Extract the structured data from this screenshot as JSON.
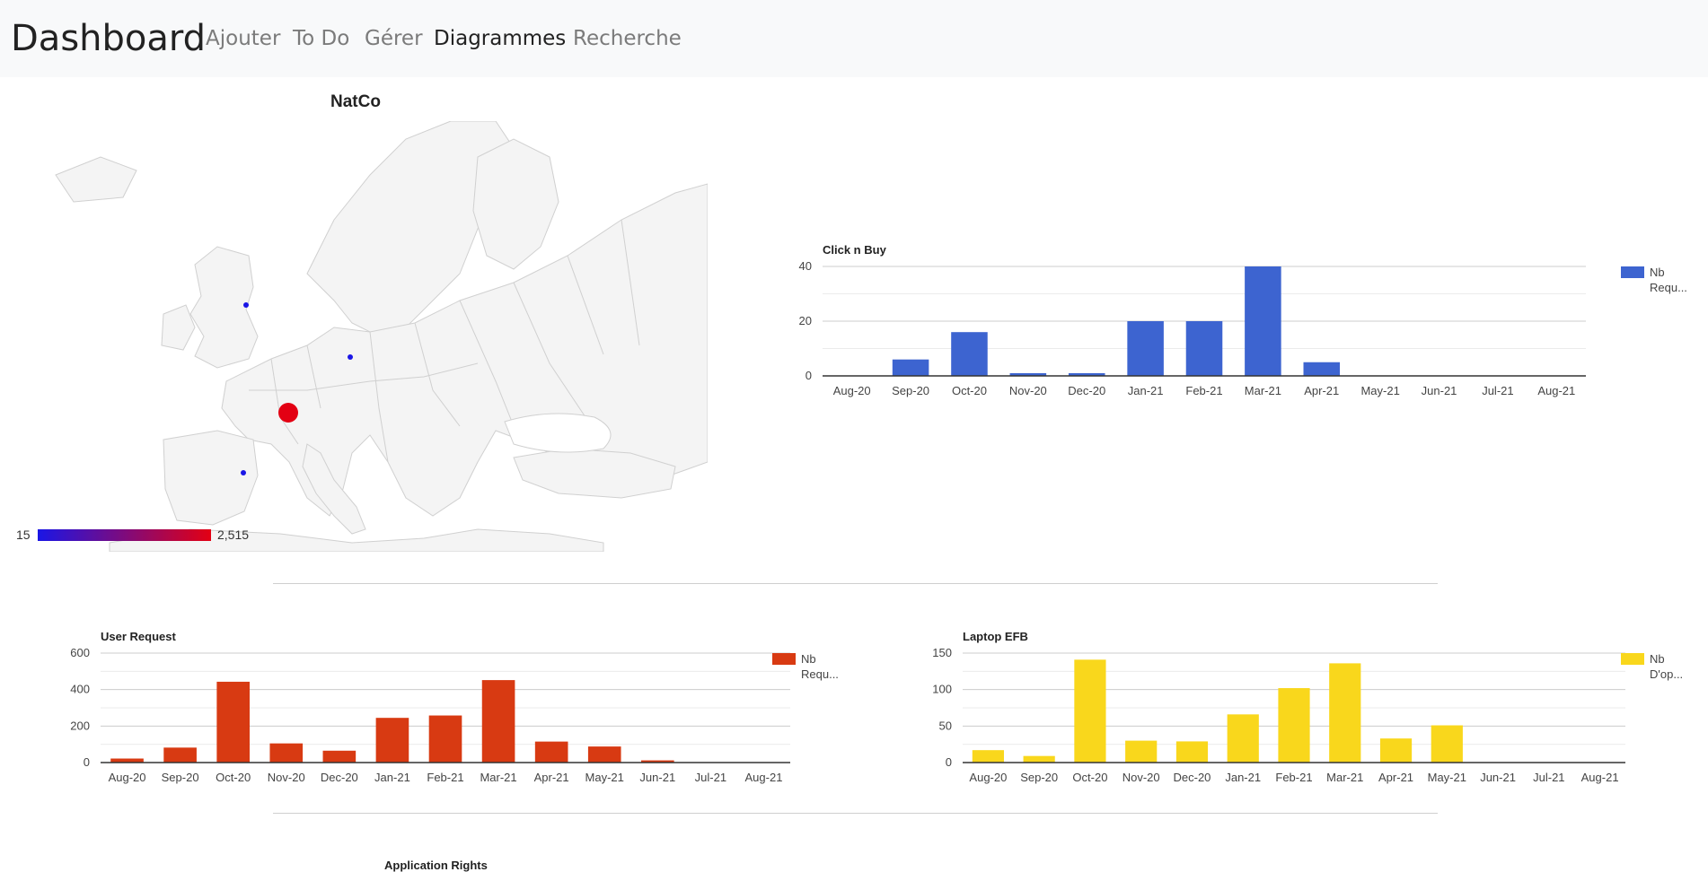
{
  "navbar": {
    "brand": "Dashboard",
    "links": [
      {
        "label": "Ajouter",
        "active": false
      },
      {
        "label": "To Do",
        "active": false
      },
      {
        "label": "Gérer",
        "active": false
      },
      {
        "label": "Diagrammes",
        "active": true
      },
      {
        "label": "Recherche",
        "active": false
      }
    ]
  },
  "map": {
    "title": "NatCo",
    "legend_min": "15",
    "legend_max": "2,515",
    "colors": {
      "min": "#1a16e6",
      "max": "#e30013",
      "land": "#f4f4f4",
      "border": "#d0d0d0"
    }
  },
  "chart_data": [
    {
      "type": "bar",
      "title": "Click n Buy",
      "categories": [
        "Aug-20",
        "Sep-20",
        "Oct-20",
        "Nov-20",
        "Dec-20",
        "Jan-21",
        "Feb-21",
        "Mar-21",
        "Apr-21",
        "May-21",
        "Jun-21",
        "Jul-21",
        "Aug-21"
      ],
      "series": [
        {
          "name": "Nb Requ...",
          "values": [
            0,
            6,
            16,
            1,
            1,
            20,
            20,
            40,
            5,
            0,
            0,
            0,
            0
          ],
          "color": "#3d64d0"
        }
      ],
      "yticks": [
        "0",
        "20",
        "40"
      ],
      "ylim": [
        0,
        40
      ],
      "legend_position": "right",
      "grid": true
    },
    {
      "type": "bar",
      "title": "User Request",
      "categories": [
        "Aug-20",
        "Sep-20",
        "Oct-20",
        "Nov-20",
        "Dec-20",
        "Jan-21",
        "Feb-21",
        "Mar-21",
        "Apr-21",
        "May-21",
        "Jun-21",
        "Jul-21",
        "Aug-21"
      ],
      "series": [
        {
          "name": "Nb Requ...",
          "values": [
            22,
            82,
            443,
            105,
            65,
            245,
            258,
            452,
            115,
            88,
            12,
            0,
            0
          ],
          "color": "#d83a12"
        }
      ],
      "yticks": [
        "0",
        "200",
        "400",
        "600"
      ],
      "ylim": [
        0,
        600
      ],
      "legend_position": "right",
      "grid": true
    },
    {
      "type": "bar",
      "title": "Laptop EFB",
      "categories": [
        "Aug-20",
        "Sep-20",
        "Oct-20",
        "Nov-20",
        "Dec-20",
        "Jan-21",
        "Feb-21",
        "Mar-21",
        "Apr-21",
        "May-21",
        "Jun-21",
        "Jul-21",
        "Aug-21"
      ],
      "series": [
        {
          "name": "Nb D'op...",
          "values": [
            17,
            9,
            141,
            30,
            29,
            66,
            102,
            136,
            33,
            51,
            0,
            0,
            0
          ],
          "color": "#f9d71c"
        }
      ],
      "yticks": [
        "0",
        "50",
        "100",
        "150"
      ],
      "ylim": [
        0,
        150
      ],
      "legend_position": "right",
      "grid": true
    }
  ],
  "partial": {
    "title": "Application Rights"
  }
}
